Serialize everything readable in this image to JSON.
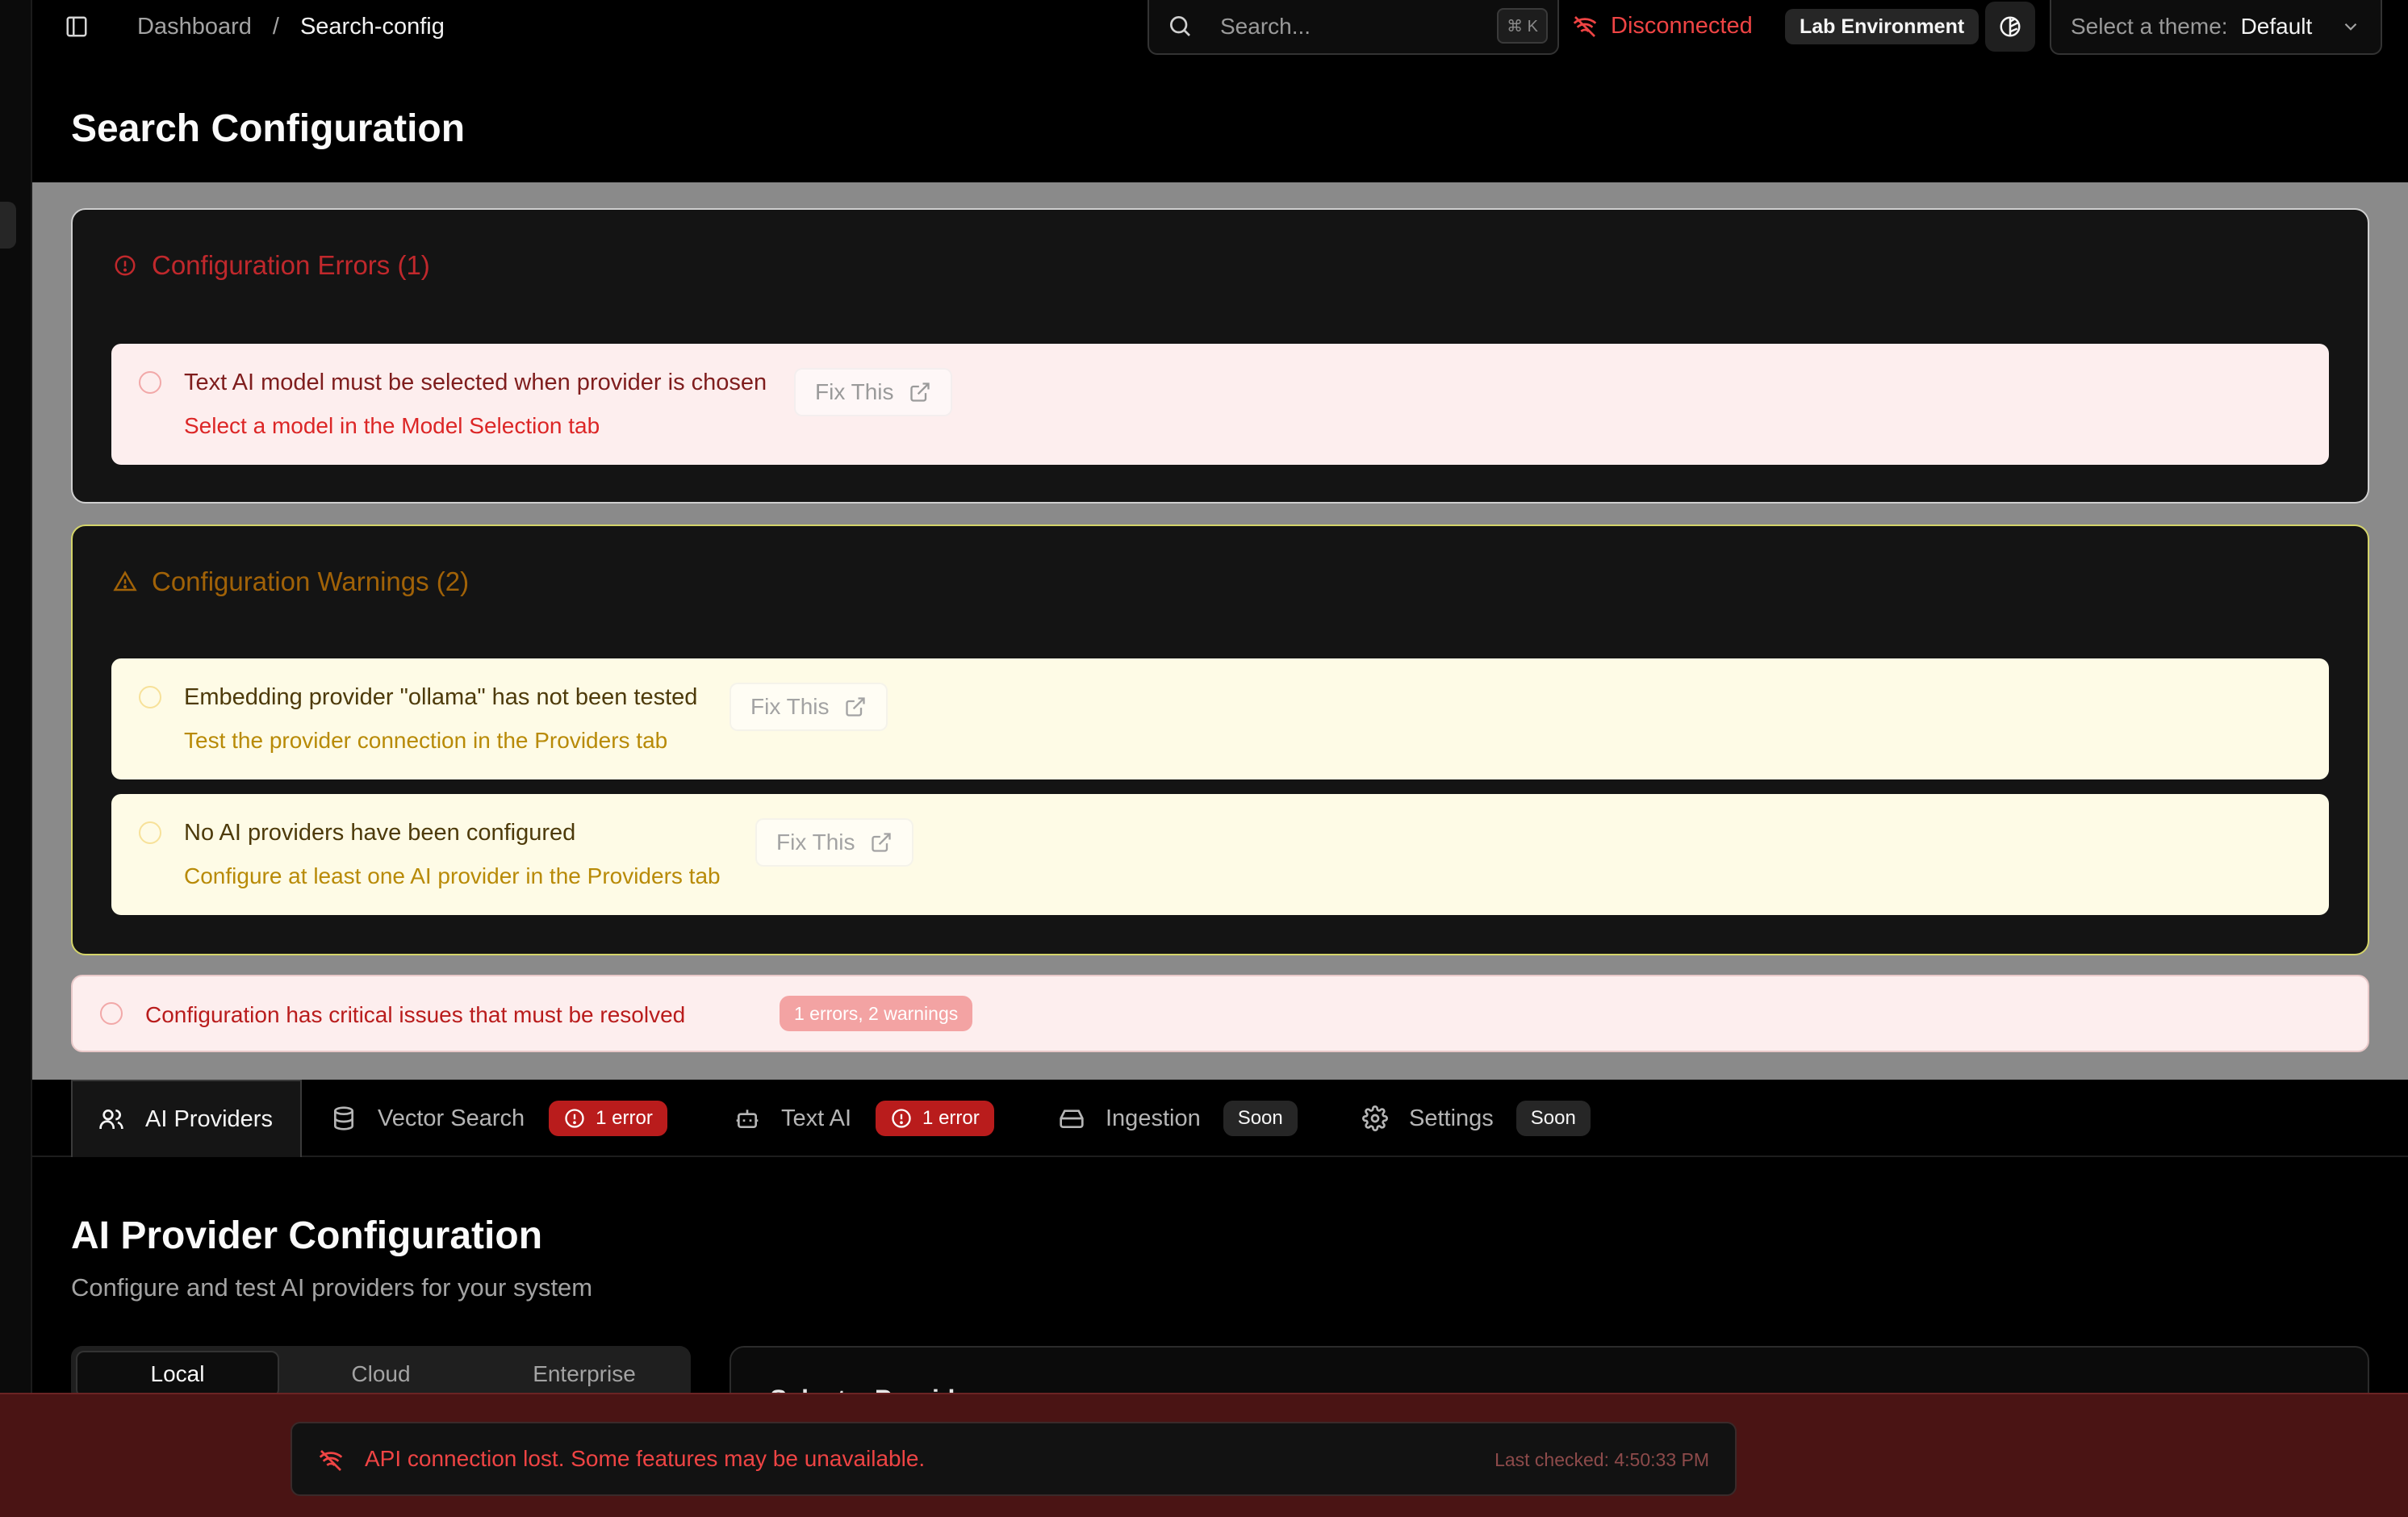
{
  "header": {
    "breadcrumb": [
      "Dashboard",
      "Search-config"
    ],
    "search_placeholder": "Search...",
    "search_shortcut": "⌘ K",
    "connection_status": "Disconnected",
    "environment": "Lab Environment",
    "theme_label": "Select a theme:",
    "theme_value": "Default"
  },
  "page": {
    "title": "Search Configuration"
  },
  "errors": {
    "heading": "Configuration Errors (1)",
    "items": [
      {
        "title": "Text AI model must be selected when provider is chosen",
        "description": "Select a model in the Model Selection tab",
        "action": "Fix This"
      }
    ]
  },
  "warnings": {
    "heading": "Configuration Warnings (2)",
    "items": [
      {
        "title": "Embedding provider \"ollama\" has not been tested",
        "description": "Test the provider connection in the Providers tab",
        "action": "Fix This"
      },
      {
        "title": "No AI providers have been configured",
        "description": "Configure at least one AI provider in the Providers tab",
        "action": "Fix This"
      }
    ]
  },
  "summary": {
    "text": "Configuration has critical issues that must be resolved",
    "badge": "1 errors, 2 warnings"
  },
  "tabs": [
    {
      "label": "AI Providers",
      "icon": "users-icon",
      "active": true
    },
    {
      "label": "Vector Search",
      "icon": "database-icon",
      "badge": "1 error"
    },
    {
      "label": "Text AI",
      "icon": "bot-icon",
      "badge": "1 error"
    },
    {
      "label": "Ingestion",
      "icon": "hard-drive-icon",
      "badge": "Soon"
    },
    {
      "label": "Settings",
      "icon": "gear-icon",
      "badge": "Soon"
    }
  ],
  "section": {
    "title": "AI Provider Configuration",
    "subtitle": "Configure and test AI providers for your system",
    "segments": [
      "Local",
      "Cloud",
      "Enterprise"
    ],
    "active_segment": "Local",
    "panel_title": "Select a Provider"
  },
  "banner": {
    "message": "API connection lost. Some features may be unavailable.",
    "last_checked": "Last checked: 4:50:33 PM"
  },
  "colors": {
    "error": "#dc2626",
    "warning": "#a16207",
    "background": "#000000",
    "banner": "#4a1414"
  }
}
